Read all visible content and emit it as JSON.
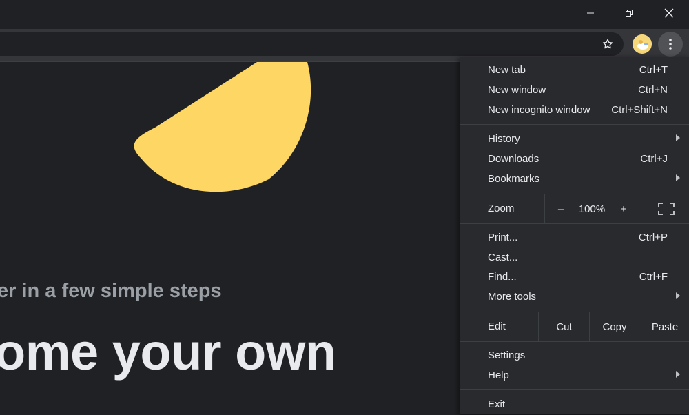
{
  "window_controls": {
    "minimize_icon": "minimize-icon",
    "restore_icon": "restore-icon",
    "close_icon": "close-icon"
  },
  "toolbar": {
    "bookmark_icon": "star-icon",
    "menu_icon": "kebab-icon"
  },
  "page": {
    "subtitle": "er in a few simple steps",
    "headline": "ome your own",
    "accent_color": "#fdd663"
  },
  "menu": {
    "group1": [
      {
        "label": "New tab",
        "shortcut": "Ctrl+T"
      },
      {
        "label": "New window",
        "shortcut": "Ctrl+N"
      },
      {
        "label": "New incognito window",
        "shortcut": "Ctrl+Shift+N"
      }
    ],
    "group2": [
      {
        "label": "History",
        "submenu": true
      },
      {
        "label": "Downloads",
        "shortcut": "Ctrl+J"
      },
      {
        "label": "Bookmarks",
        "submenu": true
      }
    ],
    "zoom": {
      "label": "Zoom",
      "minus": "–",
      "value": "100%",
      "plus": "+"
    },
    "group3": [
      {
        "label": "Print...",
        "shortcut": "Ctrl+P"
      },
      {
        "label": "Cast..."
      },
      {
        "label": "Find...",
        "shortcut": "Ctrl+F"
      },
      {
        "label": "More tools",
        "submenu": true
      }
    ],
    "edit": {
      "label": "Edit",
      "cut": "Cut",
      "copy": "Copy",
      "paste": "Paste"
    },
    "group4": [
      {
        "label": "Settings"
      },
      {
        "label": "Help",
        "submenu": true
      }
    ],
    "exit": {
      "label": "Exit"
    }
  }
}
